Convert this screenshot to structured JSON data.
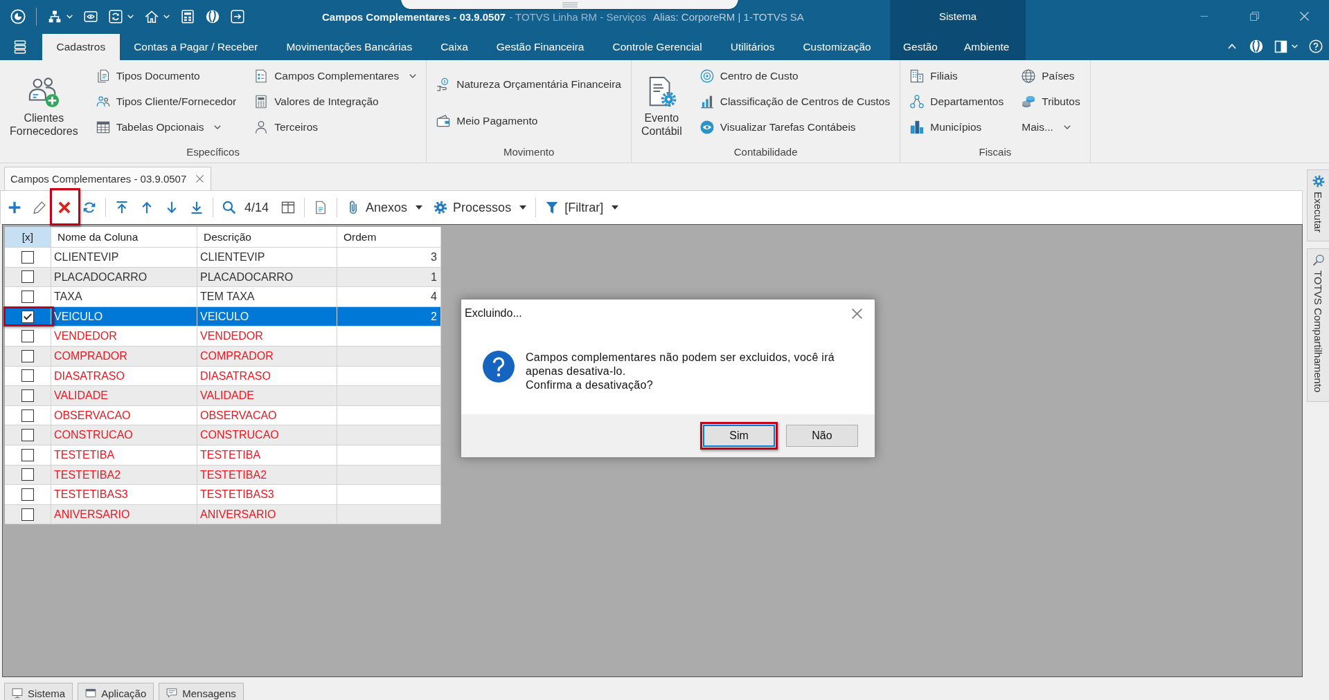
{
  "title_bar": {
    "title": "Campos Complementares - 03.9.0507",
    "product": "- TOTVS Linha RM - Serviços",
    "alias": "Alias: CorporeRM | 1-TOTVS SA",
    "section": "Sistema"
  },
  "menu_tabs": [
    {
      "label": "Cadastros",
      "selected": true
    },
    {
      "label": "Contas a Pagar / Receber",
      "selected": false
    },
    {
      "label": "Movimentações Bancárias",
      "selected": false
    },
    {
      "label": "Caixa",
      "selected": false
    },
    {
      "label": "Gestão Financeira",
      "selected": false
    },
    {
      "label": "Controle Gerencial",
      "selected": false
    },
    {
      "label": "Utilitários",
      "selected": false
    },
    {
      "label": "Customização",
      "selected": false
    }
  ],
  "system_tabs": [
    {
      "label": "Gestão",
      "selected": false
    },
    {
      "label": "Ambiente",
      "selected": false
    }
  ],
  "ribbon": [
    {
      "label": "Específicos",
      "columns": [
        [
          {
            "label": "Clientes Fornecedores",
            "kind": "large",
            "dropdown": false
          }
        ],
        [
          {
            "label": "Tipos Documento",
            "kind": "small",
            "dropdown": false
          },
          {
            "label": "Tipos Cliente/Fornecedor",
            "kind": "small",
            "dropdown": false
          },
          {
            "label": "Tabelas Opcionais",
            "kind": "small",
            "dropdown": true
          }
        ],
        [
          {
            "label": "Campos Complementares",
            "kind": "small",
            "dropdown": true
          },
          {
            "label": "Valores de Integração",
            "kind": "small",
            "dropdown": false
          },
          {
            "label": "Terceiros",
            "kind": "small",
            "dropdown": false
          }
        ]
      ]
    },
    {
      "label": "Movimento",
      "columns": [
        [
          {
            "label": "Natureza Orçamentária Financeira",
            "kind": "small",
            "dropdown": false
          },
          {
            "label": "Meio Pagamento",
            "kind": "small",
            "dropdown": false
          }
        ]
      ]
    },
    {
      "label": "Contabilidade",
      "columns": [
        [
          {
            "label": "Evento Contábil",
            "kind": "large",
            "dropdown": false
          }
        ],
        [
          {
            "label": "Centro de Custo",
            "kind": "small",
            "dropdown": false
          },
          {
            "label": "Classificação de Centros de Custos",
            "kind": "small",
            "dropdown": false
          },
          {
            "label": "Visualizar Tarefas Contábeis",
            "kind": "small",
            "dropdown": false
          }
        ]
      ]
    },
    {
      "label": "Fiscais",
      "columns": [
        [
          {
            "label": "Filiais",
            "kind": "small",
            "dropdown": false
          },
          {
            "label": "Departamentos",
            "kind": "small",
            "dropdown": false
          },
          {
            "label": "Municípios",
            "kind": "small",
            "dropdown": false
          }
        ],
        [
          {
            "label": "Países",
            "kind": "small",
            "dropdown": false
          },
          {
            "label": "Tributos",
            "kind": "small",
            "dropdown": false
          },
          {
            "label": "Mais...",
            "kind": "small",
            "dropdown": true
          }
        ]
      ]
    }
  ],
  "document_tab": {
    "label": "Campos Complementares - 03.9.0507"
  },
  "toolbar": [
    {
      "kind": "button",
      "highlighted": false
    },
    {
      "kind": "button",
      "highlighted": false
    },
    {
      "kind": "button",
      "highlighted": true
    },
    {
      "kind": "button",
      "highlighted": false
    },
    {
      "kind": "separator"
    },
    {
      "kind": "button",
      "highlighted": false
    },
    {
      "kind": "button",
      "highlighted": false
    },
    {
      "kind": "button",
      "highlighted": false
    },
    {
      "kind": "button",
      "highlighted": false
    },
    {
      "kind": "separator"
    },
    {
      "kind": "button",
      "highlighted": false
    },
    {
      "kind": "counter",
      "label": "4/14"
    },
    {
      "kind": "button",
      "highlighted": false
    },
    {
      "kind": "separator"
    },
    {
      "kind": "button",
      "highlighted": false
    },
    {
      "kind": "separator"
    },
    {
      "kind": "menu",
      "label": "Anexos",
      "highlighted": false
    },
    {
      "kind": "menu",
      "label": "Processos",
      "highlighted": false
    },
    {
      "kind": "separator"
    },
    {
      "kind": "menu",
      "label": "[Filtrar]",
      "highlighted": false
    }
  ],
  "grid": {
    "columns": [
      "[x]",
      "Nome da Coluna",
      "Descrição",
      "Ordem"
    ],
    "rows": [
      {
        "checked": false,
        "selected": false,
        "active": true,
        "highlighted": false,
        "name": "CLIENTEVIP",
        "description": "CLIENTEVIP",
        "order": "3"
      },
      {
        "checked": false,
        "selected": false,
        "active": true,
        "highlighted": false,
        "name": "PLACADOCARRO",
        "description": "PLACADOCARRO",
        "order": "1"
      },
      {
        "checked": false,
        "selected": false,
        "active": true,
        "highlighted": false,
        "name": "TAXA",
        "description": "TEM TAXA",
        "order": "4"
      },
      {
        "checked": true,
        "selected": true,
        "active": true,
        "highlighted": true,
        "name": "VEICULO",
        "description": "VEICULO",
        "order": "2"
      },
      {
        "checked": false,
        "selected": false,
        "active": false,
        "highlighted": false,
        "name": "VENDEDOR",
        "description": "VENDEDOR"
      },
      {
        "checked": false,
        "selected": false,
        "active": false,
        "highlighted": false,
        "name": "COMPRADOR",
        "description": "COMPRADOR"
      },
      {
        "checked": false,
        "selected": false,
        "active": false,
        "highlighted": false,
        "name": "DIASATRASO",
        "description": "DIASATRASO"
      },
      {
        "checked": false,
        "selected": false,
        "active": false,
        "highlighted": false,
        "name": "VALIDADE",
        "description": "VALIDADE"
      },
      {
        "checked": false,
        "selected": false,
        "active": false,
        "highlighted": false,
        "name": "OBSERVACAO",
        "description": "OBSERVACAO"
      },
      {
        "checked": false,
        "selected": false,
        "active": false,
        "highlighted": false,
        "name": "CONSTRUCAO",
        "description": "CONSTRUCAO"
      },
      {
        "checked": false,
        "selected": false,
        "active": false,
        "highlighted": false,
        "name": "TESTETIBA",
        "description": "TESTETIBA"
      },
      {
        "checked": false,
        "selected": false,
        "active": false,
        "highlighted": false,
        "name": "TESTETIBA2",
        "description": "TESTETIBA2"
      },
      {
        "checked": false,
        "selected": false,
        "active": false,
        "highlighted": false,
        "name": "TESTETIBAS3",
        "description": "TESTETIBAS3"
      },
      {
        "checked": false,
        "selected": false,
        "active": false,
        "highlighted": false,
        "name": "ANIVERSARIO",
        "description": "ANIVERSARIO"
      }
    ]
  },
  "dialog": {
    "title": "Excluindo...",
    "message": [
      "Campos complementares não podem ser excluidos, você irá apenas desativa-lo.",
      "Confirma a desativação?"
    ],
    "buttons": [
      {
        "label": "Sim",
        "default": true,
        "highlighted": true
      },
      {
        "label": "Não",
        "default": false,
        "highlighted": false
      }
    ]
  },
  "side_tabs": [
    {
      "label": "Executar"
    },
    {
      "label": "TOTVS Compartilhamento"
    }
  ],
  "bottom_tabs": [
    {
      "label": "Sistema"
    },
    {
      "label": "Aplicação"
    },
    {
      "label": "Mensagens"
    }
  ]
}
